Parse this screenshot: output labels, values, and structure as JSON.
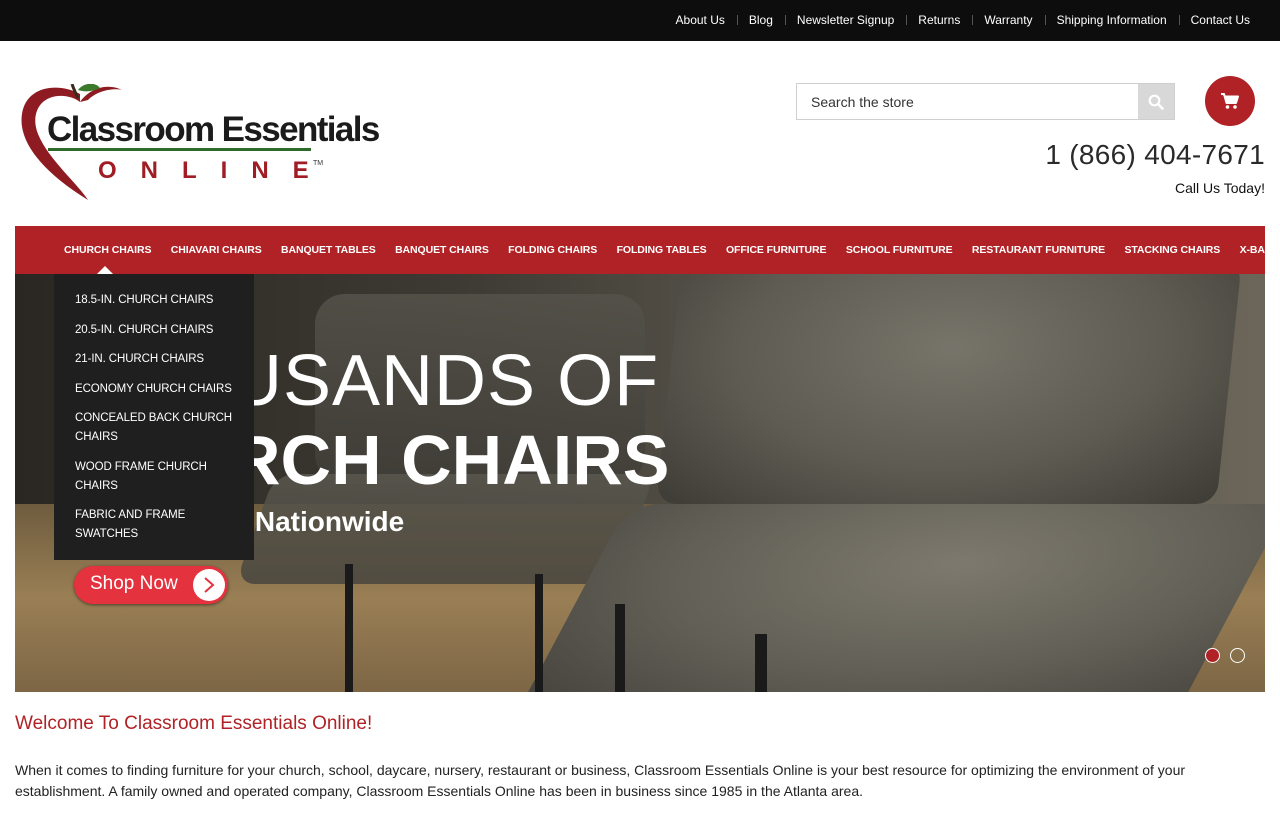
{
  "topbar": {
    "links": [
      "About Us",
      "Blog",
      "Newsletter Signup",
      "Returns",
      "Warranty",
      "Shipping Information",
      "Contact Us"
    ]
  },
  "logo": {
    "line1": "Classroom Essentials",
    "line2": "ONLINE",
    "tm": "TM"
  },
  "search": {
    "placeholder": "Search the store",
    "icon": "search-icon"
  },
  "cart": {
    "icon": "shopping-cart-icon"
  },
  "contact": {
    "phone": "1 (866) 404-7671",
    "tagline": "Call Us Today!"
  },
  "nav": {
    "items": [
      "CHURCH CHAIRS",
      "CHIAVARI CHAIRS",
      "BANQUET TABLES",
      "BANQUET CHAIRS",
      "FOLDING CHAIRS",
      "FOLDING TABLES",
      "OFFICE FURNITURE",
      "SCHOOL FURNITURE",
      "RESTAURANT FURNITURE",
      "STACKING CHAIRS",
      "X-BACK CHAIRS"
    ]
  },
  "dropdown": {
    "items": [
      "18.5-IN. CHURCH CHAIRS",
      "20.5-IN. CHURCH CHAIRS",
      "21-IN. CHURCH CHAIRS",
      "ECONOMY CHURCH CHAIRS",
      "CONCEALED BACK CHURCH CHAIRS",
      "WOOD FRAME CHURCH CHAIRS",
      "FABRIC AND FRAME SWATCHES"
    ]
  },
  "hero": {
    "line1": "USANDS OF",
    "line2": "RCH CHAIRS",
    "line3": "o Nationwide",
    "cta": "Shop Now",
    "slides": 2,
    "active_slide": 1
  },
  "welcome": {
    "heading": "Welcome To Classroom Essentials Online!",
    "body": "When it comes to finding furniture for your church, school, daycare, nursery, restaurant or business, Classroom Essentials Online is your best resource for optimizing the environment of your establishment. A family owned and operated company, Classroom Essentials Online has been in business since 1985 in the Atlanta area."
  },
  "colors": {
    "brand_red": "#b02226",
    "topbar_bg": "#0d0d0d",
    "dropdown_bg": "#1f1f1f",
    "cta_red": "#e5323f"
  }
}
